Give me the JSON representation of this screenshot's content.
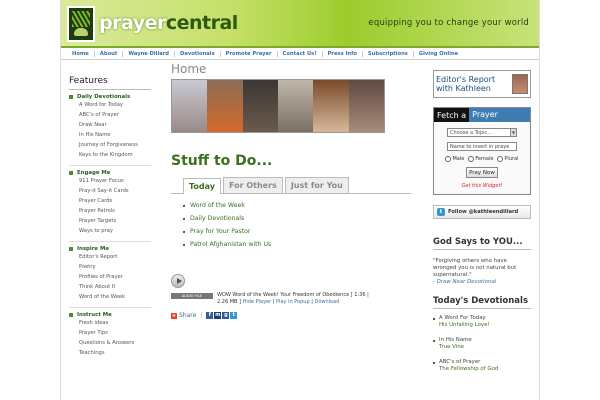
{
  "header": {
    "logo_main": "prayer",
    "logo_accent": "central",
    "tagline": "equipping you to change your world"
  },
  "nav": [
    "Home",
    "About",
    "Wayne Dillard",
    "Devotionals",
    "Promote Prayer",
    "Contact Us!",
    "Press Info",
    "Subscriptions",
    "Giving Online"
  ],
  "sidebar": {
    "title": "Features",
    "sections": [
      {
        "heading": "Daily Devotionals",
        "items": [
          "A Word for Today",
          "ABC's of Prayer",
          "Draw Near",
          "In His Name",
          "Journey of Forgiveness",
          "Keys to the Kingdom"
        ]
      },
      {
        "heading": "Engage Me",
        "items": [
          "911 Prayer Focus",
          "Pray-it Say-it Cards",
          "Prayer Cards",
          "Prayer Patrols",
          "Prayer Targets",
          "Ways to pray"
        ]
      },
      {
        "heading": "Inspire Me",
        "items": [
          "Editor's Report",
          "Poetry",
          "Profiles of Prayer",
          "Think About It",
          "Word of the Week"
        ]
      },
      {
        "heading": "Instruct Me",
        "items": [
          "Fresh ideas",
          "Prayer Tips",
          "Questions & Answers",
          "Teachings"
        ]
      }
    ]
  },
  "main": {
    "page_title": "Home",
    "section_title": "Stuff to Do...",
    "tabs": [
      {
        "label": "Today",
        "active": true
      },
      {
        "label": "For Others",
        "active": false
      },
      {
        "label": "Just for You",
        "active": false
      }
    ],
    "tab_links": [
      "Word of the Week",
      "Daily Devotionals",
      "Pray for Your Pastor",
      "Patrol Afghanistan with Us"
    ],
    "audio": {
      "badge": "AUDIO FILE",
      "title": "WOW Word of the Week! Your Freedom of Obedience",
      "duration": "[ 1:36 |",
      "size": "2.26 MB ]",
      "hide": "Hide Player",
      "popup": "Play in Popup",
      "download": "Download"
    },
    "share_label": "Share"
  },
  "right": {
    "editor_report": "Editor's Report with Kathleen",
    "fetch": {
      "title_a": "Fetch a",
      "title_b": "Prayer",
      "topic_placeholder": "Choose a Topic...",
      "name_placeholder": "Name to insert in praye",
      "radios": [
        "Male",
        "Female",
        "Plural"
      ],
      "button": "Pray Now",
      "widget": "Get this Widget!"
    },
    "follow": "Follow @kathleendillard",
    "god_says": {
      "heading": "God Says to YOU...",
      "quote": "\"Forgiving others who have wronged you is not natural but supernatural.\"",
      "ref": "- Draw Near Devotional"
    },
    "todays": {
      "heading": "Today's Devotionals",
      "items": [
        {
          "title": "A Word For Today",
          "sub": "His Unfailing Love!"
        },
        {
          "title": "In His Name",
          "sub": "True Vine"
        },
        {
          "title": "ABC's of Prayer",
          "sub": "The Fellowship of God"
        }
      ]
    }
  }
}
